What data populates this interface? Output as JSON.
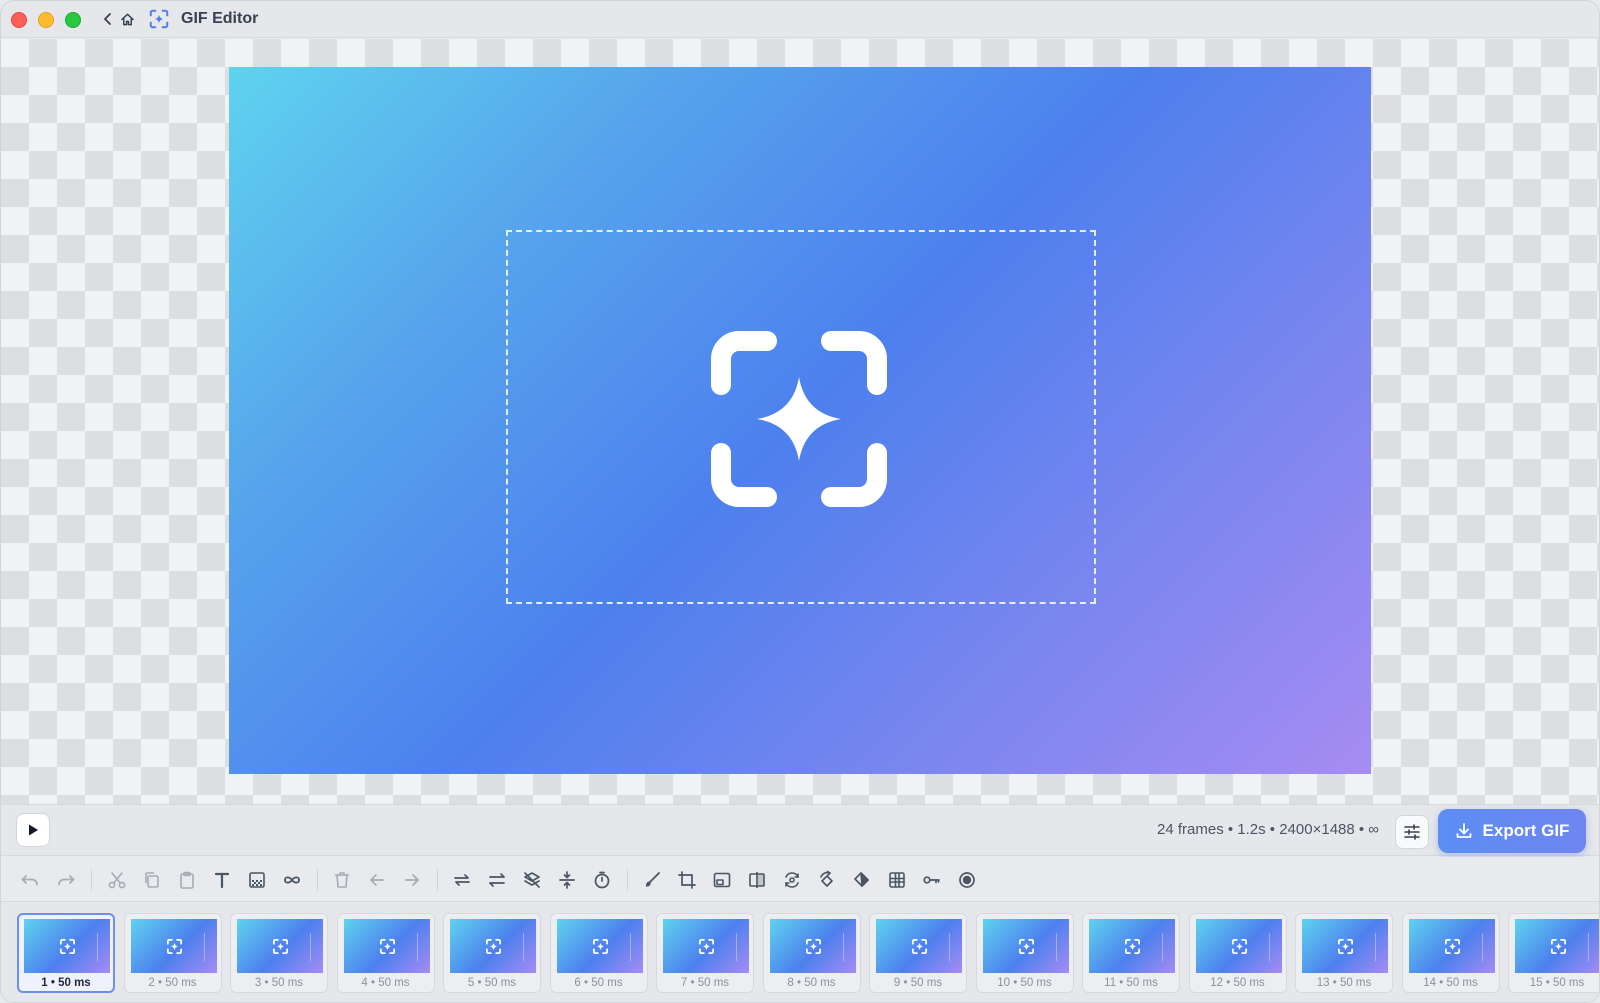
{
  "window": {
    "title": "GIF Editor"
  },
  "controls": {
    "info": "24 frames  •  1.2s  •  2400×1488  •  ∞",
    "export_label": "Export GIF"
  },
  "toolbar": {
    "tools": [
      {
        "name": "undo-icon",
        "enabled": false
      },
      {
        "name": "redo-icon",
        "enabled": false
      },
      {
        "name": "cut-icon",
        "enabled": false
      },
      {
        "name": "copy-icon",
        "enabled": false
      },
      {
        "name": "paste-icon",
        "enabled": false
      },
      {
        "name": "text-icon",
        "enabled": true
      },
      {
        "name": "overlay-icon",
        "enabled": true
      },
      {
        "name": "loop-icon",
        "enabled": true
      },
      {
        "name": "delete-icon",
        "enabled": false
      },
      {
        "name": "move-left-icon",
        "enabled": false
      },
      {
        "name": "move-right-icon",
        "enabled": false
      },
      {
        "name": "reverse-icon",
        "enabled": true
      },
      {
        "name": "yoyo-icon",
        "enabled": true
      },
      {
        "name": "remove-duplicates-icon",
        "enabled": true
      },
      {
        "name": "reduce-frames-icon",
        "enabled": true
      },
      {
        "name": "timer-icon",
        "enabled": true
      },
      {
        "name": "brush-icon",
        "enabled": true
      },
      {
        "name": "crop-icon",
        "enabled": true
      },
      {
        "name": "resize-icon",
        "enabled": true
      },
      {
        "name": "flip-icon",
        "enabled": true
      },
      {
        "name": "rotate-icon",
        "enabled": true
      },
      {
        "name": "rotate-ccw-icon",
        "enabled": true
      },
      {
        "name": "fill-icon",
        "enabled": true
      },
      {
        "name": "grid-icon",
        "enabled": true
      },
      {
        "name": "key-icon",
        "enabled": true
      },
      {
        "name": "record-icon",
        "enabled": true
      }
    ]
  },
  "frames": [
    {
      "label": "1  •  50 ms",
      "active": true
    },
    {
      "label": "2  •  50 ms",
      "active": false
    },
    {
      "label": "3  •  50 ms",
      "active": false
    },
    {
      "label": "4  •  50 ms",
      "active": false
    },
    {
      "label": "5  •  50 ms",
      "active": false
    },
    {
      "label": "6  •  50 ms",
      "active": false
    },
    {
      "label": "7  •  50 ms",
      "active": false
    },
    {
      "label": "8  •  50 ms",
      "active": false
    },
    {
      "label": "9  •  50 ms",
      "active": false
    },
    {
      "label": "10  •  50 ms",
      "active": false
    },
    {
      "label": "11  •  50 ms",
      "active": false
    },
    {
      "label": "12  •  50 ms",
      "active": false
    },
    {
      "label": "13  •  50 ms",
      "active": false
    },
    {
      "label": "14  •  50 ms",
      "active": false
    },
    {
      "label": "15  •  50 ms",
      "active": false
    }
  ],
  "colors": {
    "accent": "#5b8ef3",
    "gradient_start": "#5fd3ee",
    "gradient_mid": "#4d80ee",
    "gradient_end": "#a68cf3"
  }
}
